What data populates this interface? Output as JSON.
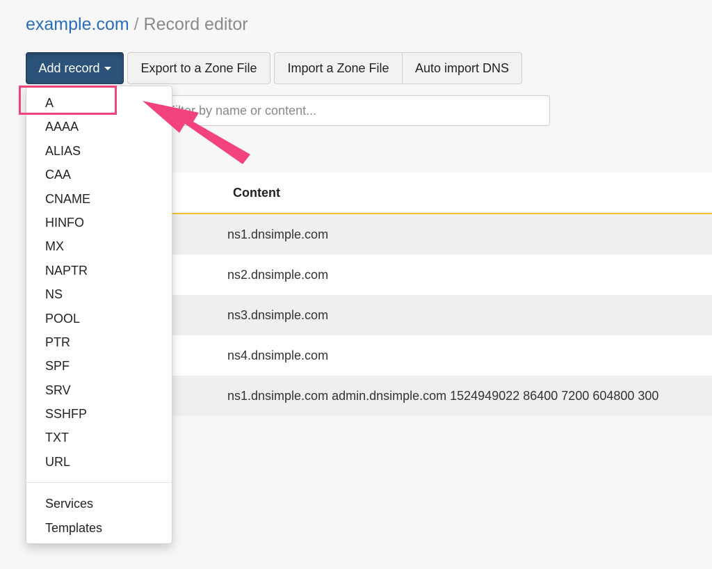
{
  "breadcrumb": {
    "domain": "example.com",
    "separator": " / ",
    "current": "Record editor"
  },
  "toolbar": {
    "add_record_label": "Add record",
    "export_label": "Export to a Zone File",
    "import_label": "Import a Zone File",
    "auto_import_label": "Auto import DNS"
  },
  "search": {
    "placeholder": "Filter by name or content..."
  },
  "table": {
    "content_header": "Content",
    "rows": [
      "ns1.dnsimple.com",
      "ns2.dnsimple.com",
      "ns3.dnsimple.com",
      "ns4.dnsimple.com",
      "ns1.dnsimple.com admin.dnsimple.com 1524949022 86400 7200 604800 300"
    ]
  },
  "dropdown": {
    "record_types": [
      "A",
      "AAAA",
      "ALIAS",
      "CAA",
      "CNAME",
      "HINFO",
      "MX",
      "NAPTR",
      "NS",
      "POOL",
      "PTR",
      "SPF",
      "SRV",
      "SSHFP",
      "TXT",
      "URL"
    ],
    "extras": [
      "Services",
      "Templates"
    ],
    "highlighted": "A"
  },
  "colors": {
    "primary_button": "#2b5278",
    "link": "#2a6ebb",
    "table_header_border": "#f2c230",
    "annotation": "#f2437d"
  }
}
